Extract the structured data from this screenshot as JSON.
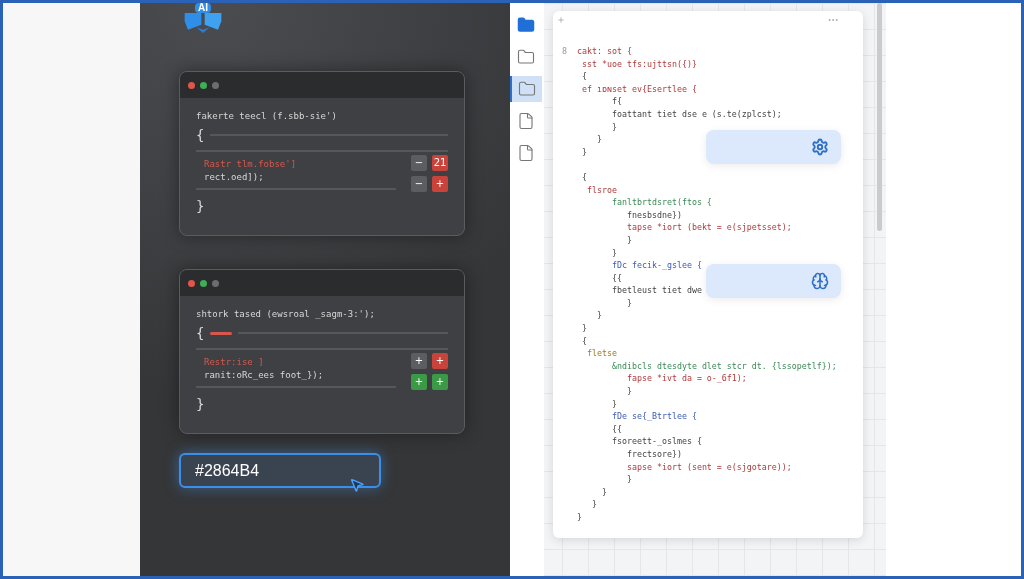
{
  "logo": {
    "text": "AI"
  },
  "cards": [
    {
      "dots": [
        {
          "color": "#e0564a"
        },
        {
          "color": "#3fae55"
        },
        {
          "color": "#6b6d70"
        }
      ],
      "lines": [
        {
          "text": "fakerte teecl (f.sbb-sie')",
          "kind": "plain"
        },
        {
          "text": "{",
          "kind": "plain"
        },
        {
          "text": "Rastr tlm.fobse']",
          "kind": "error"
        },
        {
          "text": "rect.oed]);",
          "kind": "plain"
        },
        {
          "text": "}",
          "kind": "plain"
        }
      ],
      "marker": false,
      "buttons": [
        {
          "label": "−",
          "color": "#5b5d60"
        },
        {
          "label": "21",
          "color": "#c9433a"
        },
        {
          "label": "−",
          "color": "#5b5d60"
        },
        {
          "label": "+",
          "color": "#c9433a"
        }
      ]
    },
    {
      "dots": [
        {
          "color": "#e0564a"
        },
        {
          "color": "#3fae55"
        },
        {
          "color": "#6b6d70"
        }
      ],
      "lines": [
        {
          "text": "shtork tased (ewsroal _sagm-3:');",
          "kind": "plain"
        },
        {
          "text": "{",
          "kind": "plain"
        },
        {
          "text": "Restr:ise ]",
          "kind": "error"
        },
        {
          "text": "ranit:oRc_ees foot_});",
          "kind": "plain"
        },
        {
          "text": "}",
          "kind": "plain"
        }
      ],
      "marker": true,
      "buttons": [
        {
          "label": "+",
          "color": "#5b5d60"
        },
        {
          "label": "+",
          "color": "#c9433a"
        },
        {
          "label": "+",
          "color": "#3b9a46"
        },
        {
          "label": "+",
          "color": "#3b9a46"
        }
      ]
    }
  ],
  "color_field": {
    "value": "#2864B4"
  },
  "sidebar": {
    "items": [
      {
        "kind": "folder-filled",
        "selected": false
      },
      {
        "kind": "folder",
        "selected": false
      },
      {
        "kind": "folder",
        "selected": true
      },
      {
        "kind": "file",
        "selected": false
      },
      {
        "kind": "file",
        "selected": false
      }
    ]
  },
  "editor": {
    "gutter": "8",
    "blocks": [
      {
        "lines": [
          {
            "text": "cakt: sot {",
            "kind": "keyword"
          },
          {
            "text": " sst *uoe tfs:ujttsn({)}",
            "kind": "keyword"
          },
          {
            "text": " {",
            "kind": "plain"
          },
          {
            "text": " ef ıɒɴset ev{Esertlee {",
            "kind": "keyword"
          },
          {
            "text": "       f{",
            "kind": "plain"
          },
          {
            "text": "       foattant tiet dse e (s.te(zplcst);",
            "kind": "plain"
          },
          {
            "text": "       }",
            "kind": "plain"
          },
          {
            "text": "    }",
            "kind": "plain"
          },
          {
            "text": " }",
            "kind": "plain"
          }
        ]
      },
      {
        "lines": [
          {
            "text": " {",
            "kind": "plain"
          },
          {
            "text": "  flsroe",
            "kind": "keyword"
          },
          {
            "text": "       fanltbrtdsret(ftos {",
            "kind": "call"
          },
          {
            "text": "          fnesbsdne})",
            "kind": "plain"
          },
          {
            "text": "          tapse *iort (bekt = e(sjpetsset);",
            "kind": "keyword"
          },
          {
            "text": "          }",
            "kind": "plain"
          },
          {
            "text": "       }",
            "kind": "plain"
          },
          {
            "text": "       fDc fecik-_gslee {",
            "kind": "type"
          },
          {
            "text": "       {{",
            "kind": "plain"
          },
          {
            "text": "       fbetleust tiet dwe",
            "kind": "plain"
          },
          {
            "text": "          }",
            "kind": "plain"
          },
          {
            "text": "    }",
            "kind": "plain"
          },
          {
            "text": " }",
            "kind": "plain"
          },
          {
            "text": " {",
            "kind": "plain"
          },
          {
            "text": "  fletse",
            "kind": "label"
          },
          {
            "text": "       &ndibcls dtesdyte dlet stcr dt. {lssopetlf});",
            "kind": "call"
          },
          {
            "text": "          fapse *ivt da = o-_6f1);",
            "kind": "keyword"
          },
          {
            "text": "          }",
            "kind": "plain"
          },
          {
            "text": "       }",
            "kind": "plain"
          },
          {
            "text": "       fDe se{_Btrtlee {",
            "kind": "type"
          },
          {
            "text": "       {{",
            "kind": "plain"
          },
          {
            "text": "       fsoreett-_oslmes {",
            "kind": "plain"
          },
          {
            "text": "          frectsore})",
            "kind": "plain"
          },
          {
            "text": "          sapse *iort (sent = e(sjgotare));",
            "kind": "keyword"
          },
          {
            "text": "          }",
            "kind": "plain"
          },
          {
            "text": "     }",
            "kind": "plain"
          },
          {
            "text": "   }",
            "kind": "plain"
          },
          {
            "text": "}",
            "kind": "plain"
          }
        ]
      }
    ],
    "chips": [
      {
        "kind": "gear"
      },
      {
        "kind": "brain"
      }
    ]
  }
}
